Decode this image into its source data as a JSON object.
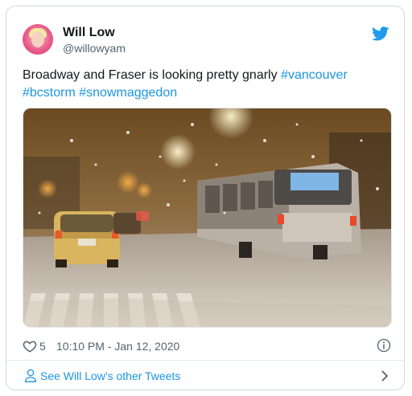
{
  "author": {
    "name": "Will Low",
    "handle": "@willowyam"
  },
  "tweet": {
    "text_plain": "Broadway and Fraser is looking pretty gnarly ",
    "hashtags": [
      "#vancouver",
      "#bcstorm",
      "#snowmaggedon"
    ]
  },
  "media": {
    "description_icon": "photo-icon"
  },
  "meta": {
    "like_count": "5",
    "timestamp": "10:10 PM - Jan 12, 2020"
  },
  "footer": {
    "label": "See Will Low's other Tweets"
  },
  "icons": {
    "brand": "twitter-bird-icon",
    "like": "heart-icon",
    "info": "info-icon",
    "profile": "person-icon",
    "chevron": "chevron-right-icon"
  },
  "colors": {
    "link": "#1b95e0",
    "text": "#14171a",
    "muted": "#536471",
    "border": "#cfd9de"
  }
}
